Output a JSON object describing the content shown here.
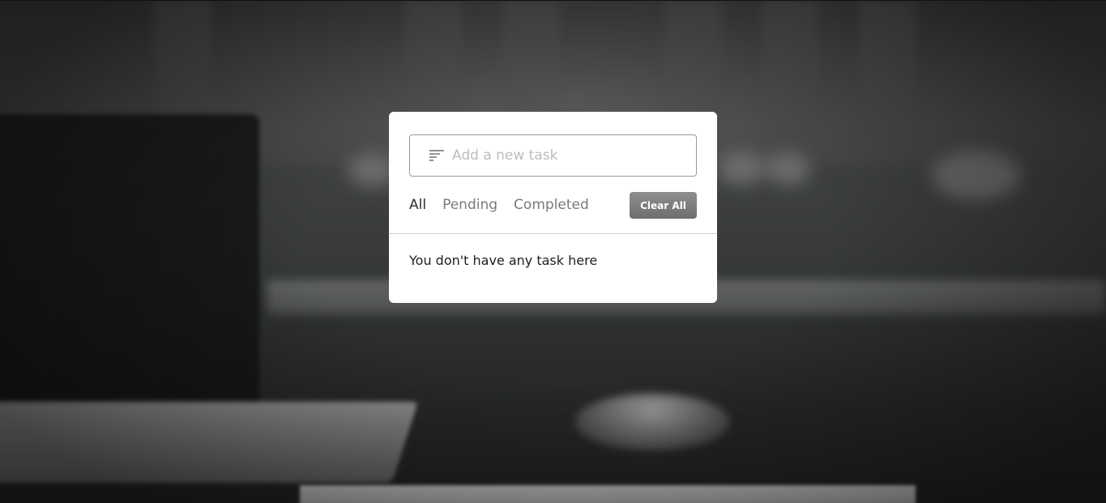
{
  "task_input": {
    "placeholder": "Add a new task",
    "value": "",
    "icon": "filter-lines-icon"
  },
  "filters": [
    {
      "label": "All",
      "active": true
    },
    {
      "label": "Pending",
      "active": false
    },
    {
      "label": "Completed",
      "active": false
    }
  ],
  "clear_button": {
    "label": "Clear All",
    "color": "#7d7d7d"
  },
  "task_list": {
    "empty_message": "You don't have any task here",
    "items": []
  },
  "colors": {
    "card_background": "#ffffff",
    "active_filter": "#2d2d2d",
    "inactive_filter": "#7a7a7a"
  }
}
